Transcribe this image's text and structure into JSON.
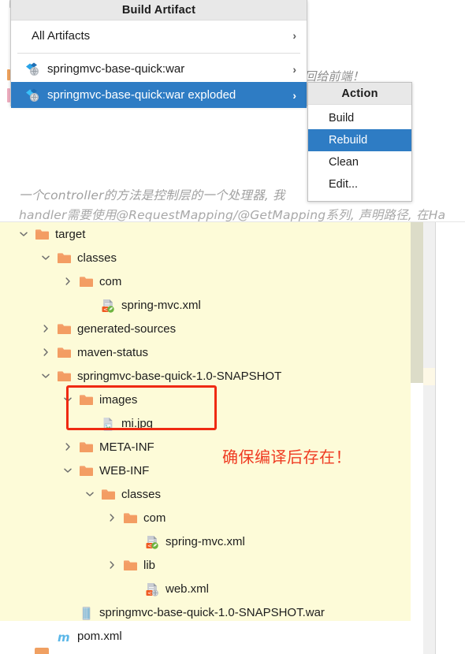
{
  "build_artifact_popup": {
    "title": "Build Artifact",
    "items": [
      {
        "label": "All Artifacts",
        "icon": "",
        "chevron": "›",
        "selected": false,
        "separator_after": true
      },
      {
        "label": "springmvc-base-quick:war",
        "icon": "artifact-icon",
        "chevron": "›",
        "selected": false,
        "separator_after": false
      },
      {
        "label": "springmvc-base-quick:war exploded",
        "icon": "artifact-icon",
        "chevron": "›",
        "selected": true,
        "separator_after": false
      }
    ]
  },
  "action_popup": {
    "title": "Action",
    "items": [
      {
        "label": "Build",
        "selected": false
      },
      {
        "label": "Rebuild",
        "selected": true
      },
      {
        "label": "Clean",
        "selected": false
      },
      {
        "label": "Edit...",
        "selected": false
      }
    ]
  },
  "article": {
    "top_fragment": "回给前端！",
    "line1": "一个controller的方法是控制层的一个处理器, 我",
    "line2": "handler需要使用@RequestMapping/@GetMapping系列, 声明路径, 在Ha"
  },
  "annotation": {
    "note": "确保编译后存在！",
    "box_color": "#ef2a12",
    "note_color": "#ef3b22"
  },
  "colors": {
    "selection_blue": "#2e7cc4",
    "folder_orange": "#f0a062",
    "tree_highlight": "#fdfbd8",
    "popup_header": "#e8e8e8",
    "maven_blue": "#5bb7e8"
  },
  "tree": {
    "rows": [
      {
        "label": "target",
        "indent": 0,
        "twisty": "expanded",
        "icon": "folder-icon"
      },
      {
        "label": "classes",
        "indent": 1,
        "twisty": "expanded",
        "icon": "folder-icon"
      },
      {
        "label": "com",
        "indent": 2,
        "twisty": "collapsed",
        "icon": "folder-icon"
      },
      {
        "label": "spring-mvc.xml",
        "indent": 3,
        "twisty": "none",
        "icon": "spring-xml-icon"
      },
      {
        "label": "generated-sources",
        "indent": 1,
        "twisty": "collapsed",
        "icon": "folder-icon"
      },
      {
        "label": "maven-status",
        "indent": 1,
        "twisty": "collapsed",
        "icon": "folder-icon"
      },
      {
        "label": "springmvc-base-quick-1.0-SNAPSHOT",
        "indent": 1,
        "twisty": "expanded",
        "icon": "folder-icon"
      },
      {
        "label": "images",
        "indent": 2,
        "twisty": "expanded",
        "icon": "folder-icon"
      },
      {
        "label": "mi.jpg",
        "indent": 3,
        "twisty": "none",
        "icon": "image-file-icon"
      },
      {
        "label": "META-INF",
        "indent": 2,
        "twisty": "collapsed",
        "icon": "folder-icon"
      },
      {
        "label": "WEB-INF",
        "indent": 2,
        "twisty": "expanded",
        "icon": "folder-icon"
      },
      {
        "label": "classes",
        "indent": 3,
        "twisty": "expanded",
        "icon": "folder-icon"
      },
      {
        "label": "com",
        "indent": 4,
        "twisty": "collapsed",
        "icon": "folder-icon"
      },
      {
        "label": "spring-mvc.xml",
        "indent": 5,
        "twisty": "none",
        "icon": "spring-xml-icon"
      },
      {
        "label": "lib",
        "indent": 4,
        "twisty": "collapsed",
        "icon": "folder-icon"
      },
      {
        "label": "web.xml",
        "indent": 5,
        "twisty": "none",
        "icon": "web-xml-icon"
      },
      {
        "label": "springmvc-base-quick-1.0-SNAPSHOT.war",
        "indent": 2,
        "twisty": "none",
        "icon": "war-archive-icon"
      },
      {
        "label": "pom.xml",
        "indent": 1,
        "twisty": "none",
        "icon": "maven-icon"
      }
    ]
  }
}
